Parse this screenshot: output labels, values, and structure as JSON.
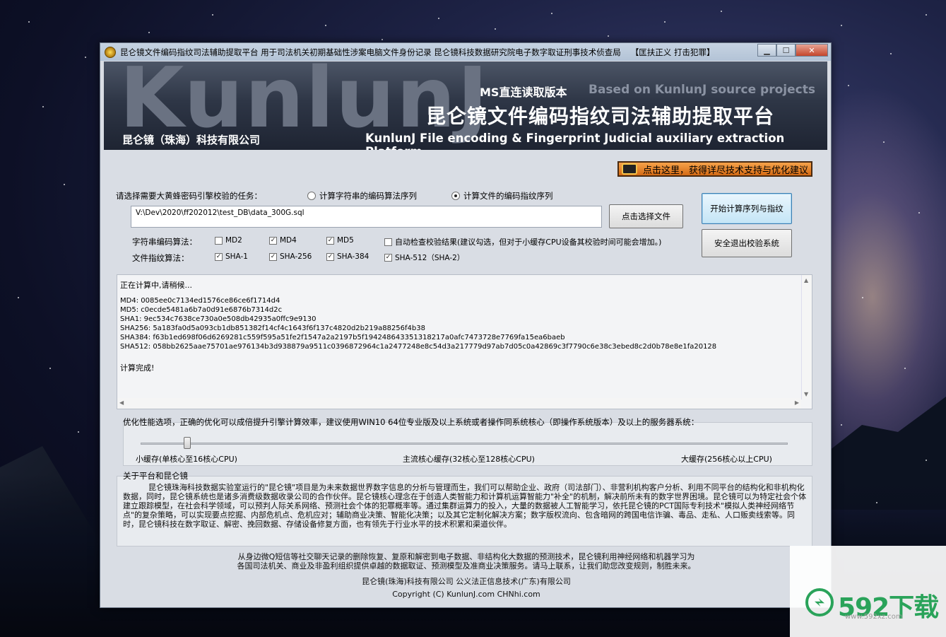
{
  "window": {
    "title": "昆仑镜文件编码指纹司法辅助提取平台 用于司法机关初期基础性涉案电脑文件身份记录 昆仑镜科技数据研究院电子数字取证刑事技术侦查局",
    "title_right": "【匡扶正义 打击犯罪】"
  },
  "banner": {
    "big": "KunlunJ",
    "version": "MS直连读取版本",
    "based_on": "Based on KunlunJ source projects",
    "title_cn": "昆仑镜文件编码指纹司法辅助提取平台",
    "company": "昆仑镜（珠海）科技有限公司",
    "title_en": "KunlunJ File encoding & Fingerprint Judicial auxiliary extraction Platform"
  },
  "support_button": "点击这里，获得详尽技术支持与优化建议",
  "task": {
    "label": "请选择需要大黄蜂密码引擎校验的任务：",
    "radio_string": "计算字符串的编码算法序列",
    "radio_file": "计算文件的编码指纹序列",
    "selected": "file",
    "path_value": "V:\\Dev\\2020\\ff202012\\test_DB\\data_300G.sql",
    "choose_file_btn": "点击选择文件",
    "start_btn": "开始计算序列与指纹",
    "exit_btn": "安全退出校验系统"
  },
  "string_algos": {
    "label": "字符串编码算法：",
    "items": [
      {
        "label": "MD2",
        "checked": false
      },
      {
        "label": "MD4",
        "checked": true
      },
      {
        "label": "MD5",
        "checked": true
      }
    ],
    "auto_check": "自动检查校验结果(建议勾选，但对于小缓存CPU设备其校验时间可能会增加。)"
  },
  "file_algos": {
    "label": "文件指纹算法：",
    "items": [
      {
        "label": "SHA-1",
        "checked": true
      },
      {
        "label": "SHA-256",
        "checked": true
      },
      {
        "label": "SHA-384",
        "checked": true
      },
      {
        "label": "SHA-512（SHA-2）",
        "checked": true
      }
    ]
  },
  "output": {
    "status": "正在计算中,请稍候...",
    "lines": [
      "MD4: 0085ee0c7134ed1576ce86ce6f1714d4",
      "MD5: c0ecde5481a6b7a0d91e6876b7314d2c",
      "SHA1: 9ec534c7638ce730a0e508db42935a0ffc9e9130",
      "SHA256: 5a183fa0d5a093cb1db851382f14cf4c1643f6f137c4820d2b219a88256f4b38",
      "SHA384: f63b1ed698f06d6269281c559f595a51fe2f1547a2a2197b5f194248643351318217a0afc7473728e7769fa15ea6baeb",
      "SHA512: 058bb2625aae75701ae976134b3d938879a9511c0396872964c1a2477248e8c54d3a217779d97ab7d05c0a42869c3f7790c6e38c3ebed8c2d0b78e8e1fa20128"
    ],
    "done": "计算完成!"
  },
  "optimization": {
    "label": "优化性能选项，正确的优化可以成倍提升引擎计算效率，建议使用WIN10 64位专业版及以上系统或者操作同系统核心（即操作系统版本）及以上的服务器系统：",
    "level": 0.07,
    "tick_small": "小缓存(单核心至16核心CPU)",
    "tick_mid": "主流核心缓存(32核心至128核心CPU)",
    "tick_large": "大缓存(256核心以上CPU)"
  },
  "about": {
    "title": "关于平台和昆仑镜",
    "text": "昆仑镜珠海科技数据实验室运行的\"昆仑镜\"项目是为未来数据世界数字信息的分析与管理而生，我们可以帮助企业、政府（司法部门）、非营利机构客户分析、利用不同平台的结构化和非机构化数据，同时，昆仑镜系统也是诸多消费级数据收录公司的合作伙伴。昆仑镜核心理念在于创造人类智能力和计算机运算智能力\"补全\"的机制，解决前所未有的数字世界困境。昆仑镜可以为特定社会个体建立跟踪模型，在社会科学领域，可以预判人际关系网络、预测社会个体的犯罪概率等。通过集群运算力的投入，大量的数据被人工智能学习，依托昆仑镜的PCT国际专利技术\"模拟人类神经网络节点\"的复杂策略，可以实现要点挖掘、内部危机点、危机应对；辅助商业决策、智能化决策；以及其它定制化解决方案；数字版权流向、包含暗网的跨国电信诈骗、毒品、走私、人口贩卖线索等。同时，昆仑镜科技在数字取证、解密、挽回数据、存储设备修复方面，也有领先于行业水平的技术积累和渠道伙伴。"
  },
  "footer": {
    "line1": "从身边微Q短信等社交聊天记录的删除恢复、复原和解密到电子数据、非结构化大数据的预测技术，昆仑镜利用神经网络和机器学习为",
    "line2": "各国司法机关、商业及非盈利组织提供卓越的数据取证、预测模型及准商业决策服务。请马上联系，让我们助您改变规则，制胜未来。",
    "line3": "昆仑镜(珠海)科技有限公司 公义法正信息技术(广东)有限公司",
    "line4": "Copyright (C) KunlunJ.com  CHNhi.com"
  },
  "watermark": {
    "brand": "592下载",
    "url": "www.592xz.com"
  }
}
